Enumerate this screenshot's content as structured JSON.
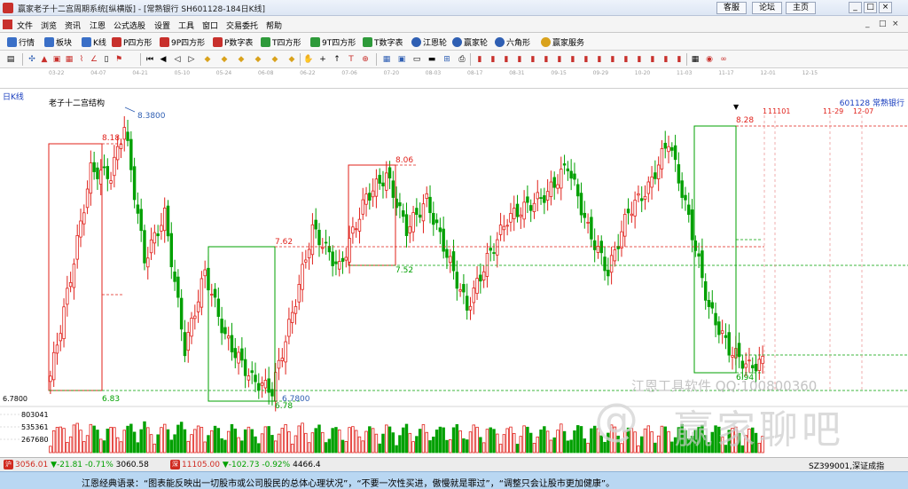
{
  "window": {
    "title": "赢家老子十二宫周期系统[纵横版] - [常熟银行  SH601128-184日K线]",
    "buttons": [
      "客服",
      "论坛",
      "主页"
    ],
    "controls": [
      "_",
      "□",
      "×"
    ]
  },
  "menubar": {
    "items": [
      "文件",
      "浏览",
      "资讯",
      "江恩",
      "公式选股",
      "设置",
      "工具",
      "窗口",
      "交易委托",
      "帮助"
    ],
    "mdi_controls": [
      "_",
      "□",
      "×"
    ]
  },
  "toolbar1": {
    "items": [
      {
        "label": "行情",
        "color": "#3a6fc7"
      },
      {
        "label": "板块",
        "color": "#3a6fc7"
      },
      {
        "label": "K线",
        "color": "#3a6fc7"
      },
      {
        "label": "P四方形",
        "color": "#c8302c"
      },
      {
        "label": "9P四方形",
        "color": "#c8302c"
      },
      {
        "label": "P数字表",
        "color": "#c8302c"
      },
      {
        "label": "T四方形",
        "color": "#2e9a3a"
      },
      {
        "label": "9T四方形",
        "color": "#2e9a3a"
      },
      {
        "label": "T数字表",
        "color": "#2e9a3a"
      },
      {
        "label": "江恩轮",
        "color": "#2f5fb3"
      },
      {
        "label": "赢家轮",
        "color": "#2f5fb3"
      },
      {
        "label": "六角形",
        "color": "#2f5fb3"
      },
      {
        "label": "赢家服务",
        "color": "#d9a21c"
      }
    ]
  },
  "timeaxis": {
    "ticks": [
      "03-22",
      "04-07",
      "04-21",
      "05-10",
      "05-24",
      "06-08",
      "06-22",
      "07-06",
      "07-20",
      "08-03",
      "08-17",
      "08-31",
      "09-15",
      "09-29",
      "10-20",
      "11-03",
      "11-17",
      "12-01",
      "12-15"
    ],
    "period": "日K线",
    "stock": "601128  常熟银行",
    "indicator": "老子十二宫结构"
  },
  "chart_data": {
    "type": "candlestick",
    "colors": {
      "up": "#e0201a",
      "down": "#00a000",
      "box_green": "#00a000",
      "box_red": "#e0201a"
    },
    "price_levels": {
      "high": 8.38,
      "low": 6.78
    },
    "labels": {
      "hi_marker": "8.3800",
      "lo_marker": "6.7800",
      "left_axis": "6.7800",
      "levels": [
        "8.18",
        "6.83",
        "8.06",
        "7.62",
        "7.52",
        "6.78",
        "8.28",
        "6.94"
      ]
    },
    "volume_axis": [
      "803041",
      "535361",
      "267680"
    ],
    "forecast_dates": [
      "11101",
      "11-29",
      "12-07"
    ],
    "forecast_prefix": "1"
  },
  "statusbar": {
    "sh_index": {
      "value": "3056.01",
      "change": "▼-21.81",
      "pct": "-0.71%",
      "amount": "3060.58"
    },
    "sz_index": {
      "value": "11105.00",
      "change": "▼-102.73",
      "pct": "-0.92%",
      "amount": "4466.4"
    },
    "right_label": "SZ399001,深证成指",
    "sh_icon": "沪",
    "sz_icon": "深"
  },
  "quote": {
    "text": "江恩经典语录：“图表能反映出一切股市或公司股民的总体心理状况”，“不要一次性买进，傲慢就是罪过”，“调整只会让股市更加健康”。"
  },
  "watermarks": {
    "company": "江恩工具软件  QQ:100800360",
    "forum": "赢家聊吧",
    "logo": "@"
  }
}
